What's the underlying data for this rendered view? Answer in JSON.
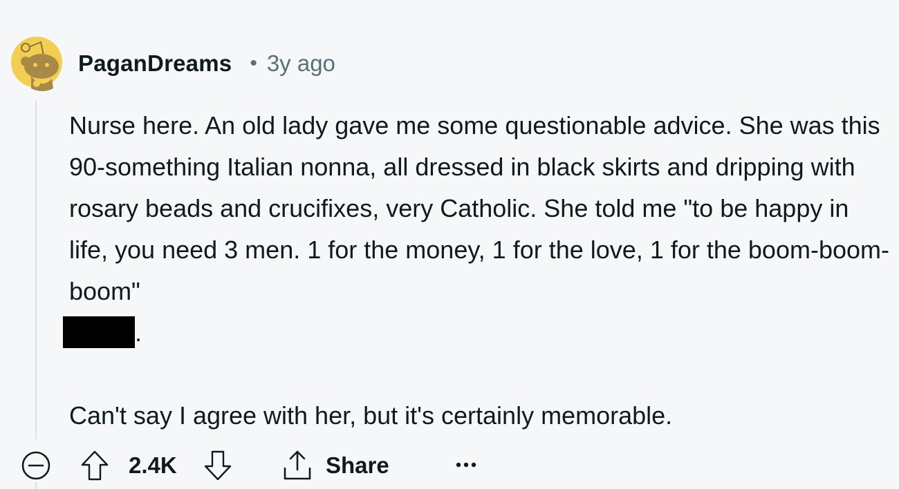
{
  "comment": {
    "author": "PaganDreams",
    "separator": "•",
    "timestamp": "3y ago",
    "body_paragraph_1": "Nurse here. An old lady gave me some questionable advice. She was this 90-something Italian nonna, all dressed in black skirts and dripping with rosary beads and crucifixes, very Catholic. She told me \"to be happy in life, you need 3 men. 1 for the money, 1 for the love, 1 for the boom-boom-boom\"",
    "body_paragraph_1_end": ".",
    "body_paragraph_2": "Can't say I agree with her, but it's certainly memorable."
  },
  "actions": {
    "score": "2.4K",
    "share_label": "Share"
  },
  "icons": {
    "avatar": "snoo-avatar-icon",
    "collapse": "minus-circle-icon",
    "upvote": "upvote-arrow-icon",
    "downvote": "downvote-arrow-icon",
    "share": "share-icon",
    "more": "ellipsis-icon"
  },
  "colors": {
    "background": "#f6f7f9",
    "text": "#0f1a1c",
    "meta_text": "#576f76",
    "avatar_yellow": "#f2cf52",
    "avatar_figure": "#a78a45",
    "thread_line": "#dbe0e2"
  }
}
